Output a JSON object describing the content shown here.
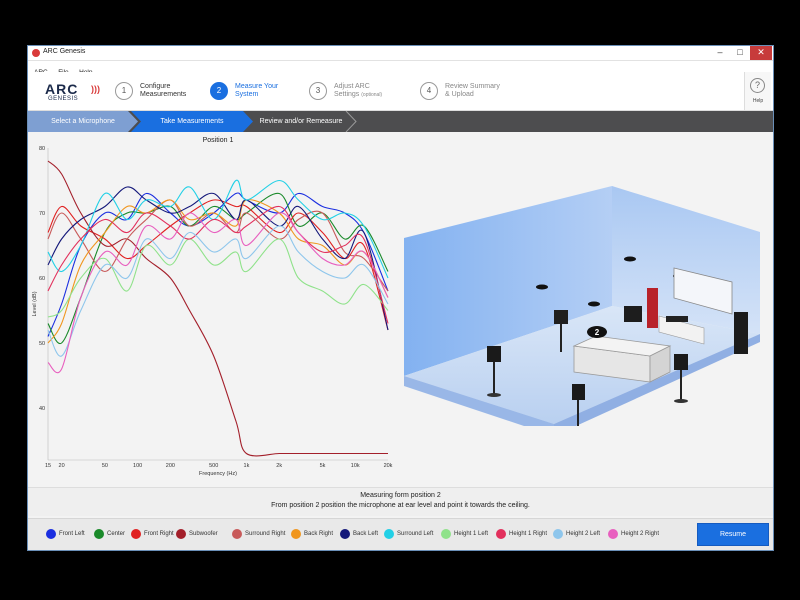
{
  "window": {
    "title": "ARC Genesis"
  },
  "menu": [
    "ARC",
    "File",
    "Help"
  ],
  "logo": {
    "main": "ARC",
    "sub": "GENESIS"
  },
  "steps": [
    {
      "num": "1",
      "line1": "Configure",
      "line2": "Measurements",
      "note": ""
    },
    {
      "num": "2",
      "line1": "Measure Your",
      "line2": "System",
      "note": ""
    },
    {
      "num": "3",
      "line1": "Adjust ARC",
      "line2": "Settings",
      "note": "(optional)"
    },
    {
      "num": "4",
      "line1": "Review Summary",
      "line2": "& Upload",
      "note": ""
    }
  ],
  "help": {
    "glyph": "?",
    "label": "Help"
  },
  "breadcrumbs": [
    "Select a Microphone",
    "Take Measurements",
    "Review and/or Remeasure"
  ],
  "chart_data": {
    "type": "line",
    "title": "Position 1",
    "xlabel": "Frequency (Hz)",
    "ylabel": "Level (dB)",
    "x_scale": "log",
    "xlim": [
      15,
      20000
    ],
    "ylim": [
      32,
      80
    ],
    "grid": false,
    "x_ticks": [
      {
        "v": 15,
        "label": "15"
      },
      {
        "v": 20,
        "label": "20"
      },
      {
        "v": 50,
        "label": "50"
      },
      {
        "v": 100,
        "label": "100"
      },
      {
        "v": 200,
        "label": "200"
      },
      {
        "v": 500,
        "label": "500"
      },
      {
        "v": 1000,
        "label": "1k"
      },
      {
        "v": 2000,
        "label": "2k"
      },
      {
        "v": 5000,
        "label": "5k"
      },
      {
        "v": 10000,
        "label": "10k"
      },
      {
        "v": 20000,
        "label": "20k"
      }
    ],
    "y_ticks": [
      40,
      50,
      60,
      70,
      80
    ],
    "x": [
      15,
      20,
      30,
      50,
      80,
      120,
      200,
      300,
      500,
      800,
      1000,
      2000,
      3000,
      5000,
      8000,
      12000,
      20000
    ],
    "series": [
      {
        "name": "Front Left",
        "color": "#1a2ee0",
        "values": [
          51,
          56,
          65,
          70,
          69,
          73,
          70,
          68,
          70,
          73,
          72,
          70,
          73,
          71,
          70,
          67,
          58
        ]
      },
      {
        "name": "Center",
        "color": "#1a8a2a",
        "values": [
          53,
          50,
          57,
          67,
          70,
          70,
          71,
          68,
          71,
          69,
          70,
          73,
          68,
          70,
          66,
          68,
          61
        ]
      },
      {
        "name": "Front Right",
        "color": "#e02020",
        "values": [
          67,
          71,
          68,
          66,
          63,
          65,
          68,
          70,
          72,
          71,
          71,
          67,
          70,
          67,
          63,
          65,
          52
        ]
      },
      {
        "name": "Subwoofer",
        "color": "#a31f2a",
        "values": [
          78,
          76,
          70,
          65,
          66,
          63,
          60,
          55,
          48,
          38,
          33,
          33,
          33,
          33,
          33,
          33,
          33
        ]
      },
      {
        "name": "Surround Right",
        "color": "#c85a5a",
        "values": [
          66,
          70,
          66,
          61,
          66,
          69,
          72,
          68,
          70,
          67,
          70,
          66,
          69,
          70,
          64,
          63,
          58
        ]
      },
      {
        "name": "Back Right",
        "color": "#f0961e",
        "values": [
          50,
          53,
          62,
          67,
          71,
          70,
          72,
          69,
          70,
          68,
          72,
          70,
          66,
          65,
          62,
          64,
          57
        ]
      },
      {
        "name": "Back Left",
        "color": "#14187a",
        "values": [
          62,
          66,
          69,
          71,
          74,
          72,
          70,
          71,
          73,
          69,
          72,
          68,
          71,
          66,
          63,
          67,
          52
        ]
      },
      {
        "name": "Surround Left",
        "color": "#22d0e6",
        "values": [
          64,
          61,
          65,
          73,
          69,
          72,
          71,
          74,
          69,
          75,
          72,
          75,
          72,
          69,
          70,
          68,
          60
        ]
      },
      {
        "name": "Height 1 Left",
        "color": "#8fe28a",
        "values": [
          54,
          55,
          60,
          63,
          58,
          65,
          62,
          66,
          62,
          64,
          61,
          66,
          60,
          58,
          56,
          59,
          55
        ]
      },
      {
        "name": "Height 1 Right",
        "color": "#e2305c",
        "values": [
          58,
          62,
          66,
          69,
          67,
          70,
          68,
          66,
          69,
          67,
          68,
          71,
          67,
          64,
          65,
          66,
          53
        ]
      },
      {
        "name": "Height 2 Left",
        "color": "#8ec6ec",
        "values": [
          52,
          48,
          55,
          62,
          60,
          66,
          63,
          67,
          64,
          66,
          63,
          68,
          64,
          61,
          60,
          62,
          56
        ]
      },
      {
        "name": "Height 2 Right",
        "color": "#e85fbf",
        "values": [
          47,
          46,
          57,
          64,
          62,
          68,
          66,
          70,
          67,
          69,
          65,
          70,
          67,
          63,
          62,
          64,
          57
        ]
      }
    ]
  },
  "room": {
    "marker": "2"
  },
  "instructions": {
    "title": "Measuring form position 2",
    "text": "From position 2 position the microphone at ear level and point it towards the ceiling."
  },
  "legend": [
    {
      "label": "Front Left",
      "color": "#1a2ee0"
    },
    {
      "label": "Center",
      "color": "#1a8a2a"
    },
    {
      "label": "Front Right",
      "color": "#e02020"
    },
    {
      "label": "Subwoofer",
      "color": "#a31f2a"
    },
    {
      "label": "Surround Right",
      "color": "#c85a5a"
    },
    {
      "label": "Back Right",
      "color": "#f0961e"
    },
    {
      "label": "Back Left",
      "color": "#14187a"
    },
    {
      "label": "Surround Left",
      "color": "#22d0e6"
    },
    {
      "label": "Height 1 Left",
      "color": "#8fe28a"
    },
    {
      "label": "Height 1 Right",
      "color": "#e2305c"
    },
    {
      "label": "Height 2 Left",
      "color": "#8ec6ec"
    },
    {
      "label": "Height 2 Right",
      "color": "#e85fbf"
    }
  ],
  "buttons": {
    "resume": "Resume"
  },
  "colors": {
    "accent": "#1a6fe0",
    "crumb_done": "#7e9fd2",
    "crumb_bar": "#4d4d4f"
  }
}
